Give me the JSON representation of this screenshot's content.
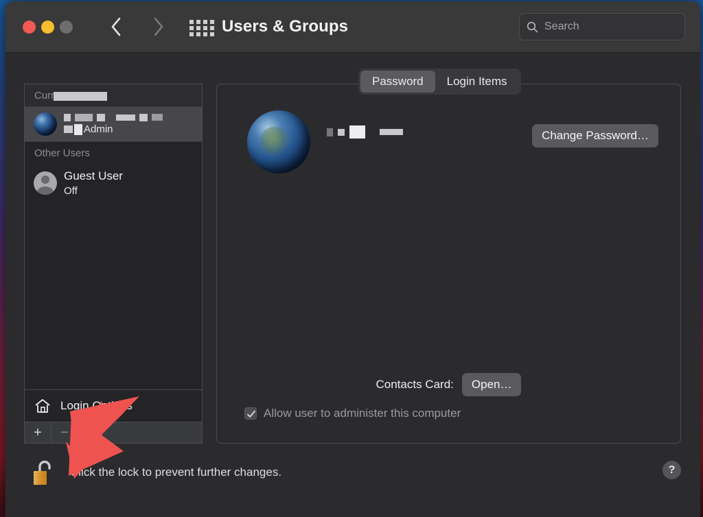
{
  "titlebar": {
    "title": "Users & Groups",
    "back_icon": "chevron-left-icon",
    "forward_icon": "chevron-right-icon",
    "grid_icon": "grid-apps-icon",
    "search_placeholder": "Search",
    "search_value": "",
    "search_icon": "search-icon",
    "close_label": "Close",
    "minimize_label": "Minimize",
    "zoom_label": "Zoom"
  },
  "sidebar": {
    "groups": [
      {
        "label": "Current User",
        "redacted": true
      },
      {
        "label": "Other Users",
        "redacted": false
      }
    ],
    "current_user": {
      "name": "",
      "name_redacted": true,
      "role": "Admin",
      "avatar_icon": "globe-avatar-icon",
      "selected": true
    },
    "other_users": [
      {
        "name": "Guest User",
        "status": "Off",
        "avatar_icon": "person-avatar-icon"
      }
    ],
    "login_options": {
      "label": "Login Options",
      "icon": "home-icon"
    },
    "add_button": "+",
    "remove_button": "−"
  },
  "panel": {
    "tabs": [
      {
        "label": "Password",
        "active": true
      },
      {
        "label": "Login Items",
        "active": false
      }
    ],
    "account": {
      "avatar_icon": "globe-avatar-icon",
      "name": "",
      "name_redacted": true
    },
    "change_password_label": "Change Password…",
    "contacts_card_label": "Contacts Card:",
    "contacts_open_label": "Open…",
    "admin_checkbox": {
      "label": "Allow user to administer this computer",
      "checked": true,
      "enabled": false,
      "check_icon": "checkmark-icon"
    }
  },
  "footer": {
    "lock_icon": "unlocked-padlock-icon",
    "lock_text": "Click the lock to prevent further changes.",
    "help_label": "?",
    "help_icon": "help-question-icon"
  },
  "annotation": {
    "arrow_icon": "red-arrow-pointer",
    "color": "#ef5350",
    "points_to": "add-user-button"
  },
  "colors": {
    "window_bg": "#2b2b2e",
    "titlebar_bg": "#393939",
    "sidebar_bg": "#242426",
    "selection_bg": "#47474b",
    "accent_red": "#ef5350",
    "lock_gold": "#e3a33a",
    "traffic_red": "#f25a54",
    "traffic_yellow": "#f6bd2f",
    "traffic_grey": "#6d6d70"
  }
}
